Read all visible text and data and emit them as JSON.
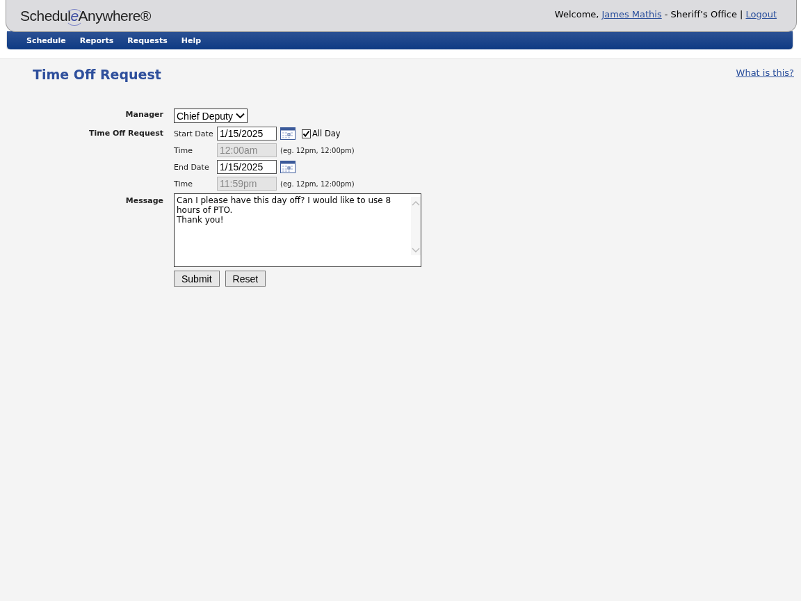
{
  "header": {
    "logo": [
      "Schedul",
      "e",
      "Anywhere®"
    ],
    "welcome": "Welcome,",
    "user_link": "James Mathis",
    "org": "- Sheriff’s Office |",
    "logout_link": "Logout"
  },
  "nav": [
    {
      "label": "Schedule"
    },
    {
      "label": "Reports"
    },
    {
      "label": "Requests"
    },
    {
      "label": "Help"
    }
  ],
  "page": {
    "title": "Time Off Request",
    "help_link": "What is this?"
  },
  "form": {
    "manager": {
      "label": "Manager",
      "value": "Chief Deputy"
    },
    "time_off": {
      "label": "Time Off Request",
      "rows": [
        {
          "kind": "date",
          "label": "Start Date",
          "value": "1/15/2025",
          "all_day": {
            "label": "All Day",
            "checked": true
          }
        },
        {
          "kind": "time",
          "label": "Time",
          "value": "12:00am",
          "disabled": true,
          "hint": "(eg. 12pm, 12:00pm)"
        },
        {
          "kind": "date",
          "label": "End Date",
          "value": "1/15/2025"
        },
        {
          "kind": "time",
          "label": "Time",
          "value": "11:59pm",
          "disabled": true,
          "hint": "(eg. 12pm, 12:00pm)"
        }
      ]
    },
    "message": {
      "label": "Message",
      "value": "Can I please have this day off? I would like to use 8 hours of PTO.\nThank you!"
    },
    "buttons": [
      {
        "label": "Submit"
      },
      {
        "label": "Reset"
      }
    ]
  }
}
